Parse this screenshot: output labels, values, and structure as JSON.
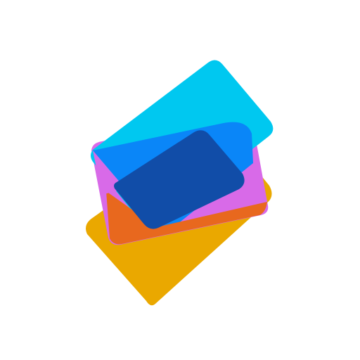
{
  "logo": {
    "icon": "stacked-cards-icon",
    "colors": {
      "background": "#FFFFFF",
      "yellow_card": "#EAA800",
      "magenta_card": "#D86AE8",
      "cyan_card": "#00C8F0",
      "blue_overlap": "#0A86F8",
      "orange_overlap": "#E8681E",
      "deep_blue_center": "#114DA8"
    }
  }
}
